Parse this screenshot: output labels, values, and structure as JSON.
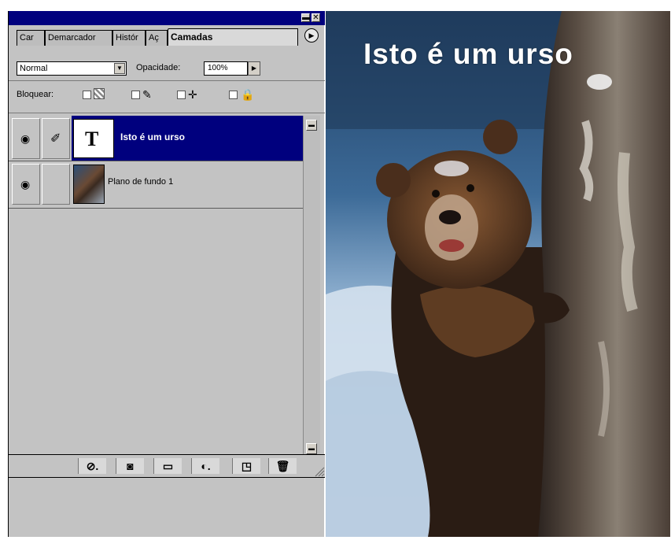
{
  "tabs": [
    {
      "label": "Car"
    },
    {
      "label": "Demarcador"
    },
    {
      "label": "Histór"
    },
    {
      "label": "Aç"
    },
    {
      "label": "Camadas"
    }
  ],
  "blend_mode": {
    "value": "Normal"
  },
  "opacity": {
    "label": "Opacidade:",
    "value": "100%"
  },
  "lock": {
    "label": "Bloquear:"
  },
  "layers": [
    {
      "name": "Isto é um urso",
      "thumb_letter": "T",
      "selected": true
    },
    {
      "name": "Plano de fundo 1",
      "selected": false
    }
  ],
  "photo": {
    "title": "Isto é um urso"
  },
  "colors": {
    "titlebar": "#00007e",
    "selection": "#00007e",
    "panel": "#c3c3c3"
  },
  "icons": {
    "layer1_visibility": "eye-icon",
    "layer1_link": "brush-icon",
    "layer2_visibility": "eye-icon",
    "bottom": [
      "layer-style-icon",
      "mask-icon",
      "folder-icon",
      "adjustment-layer-icon",
      "new-layer-icon",
      "trash-icon"
    ]
  }
}
